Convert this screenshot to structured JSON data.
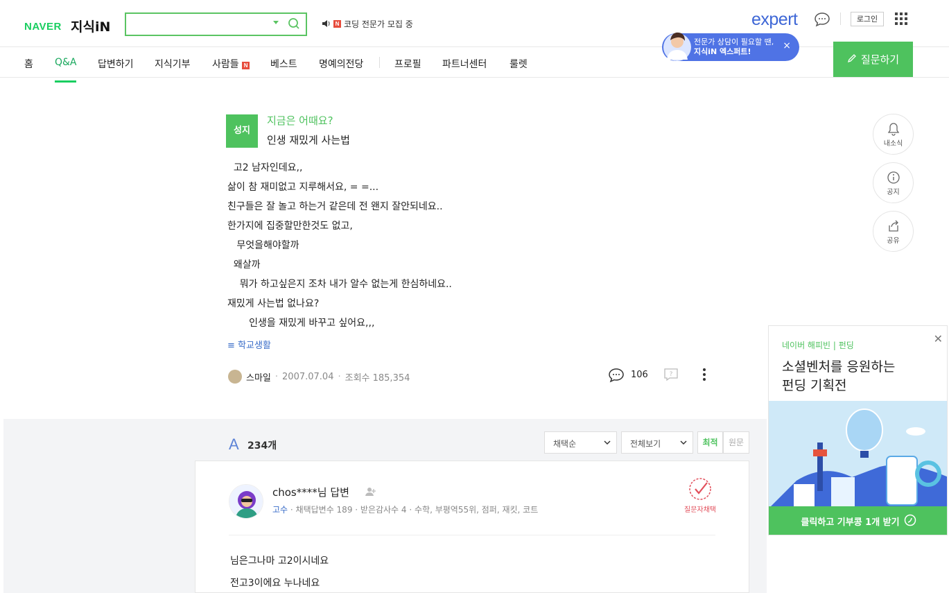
{
  "header": {
    "naver_logo": "NAVER",
    "service_name": "지식iN",
    "search": {
      "value": "",
      "placeholder": ""
    },
    "notice_text": "코딩 전문가 모집 중",
    "expert_logo": "expert",
    "login_label": "로그인"
  },
  "tooltip": {
    "line1": "전문가 상담이 필요할 땐,",
    "line2": "지식iN 엑스퍼트!",
    "close": "×"
  },
  "nav": {
    "items": [
      "홈",
      "Q&A",
      "답변하기",
      "지식기부",
      "사람들",
      "베스트",
      "명예의전당",
      "프로필",
      "파트너센터",
      "룰렛"
    ],
    "active": "Q&A",
    "ask_label": "질문하기"
  },
  "question": {
    "badge": "성지",
    "subtitle": "지금은 어때요?",
    "title": "인생 재밌게 사는법",
    "body": "  고2 남자인데요,,\n삶이 참 재미없고 지루해서요, = =...\n친구들은 잘 놀고 하는거 같은데 전 왠지 잘안되네요..\n한가지에 집중할만한것도 없고,\n   무엇을해야할까\n  왜살까\n    뭐가 하고싶은지 조차 내가 알수 없는게 한심하네요..\n재밌게 사는법 없나요?\n       인생을 재밌게 바꾸고 싶어요,,,",
    "tag": "학교생활",
    "author": "스마일",
    "date": "2007.07.04",
    "views": "조회수 185,354",
    "comment_count": "106"
  },
  "side": {
    "alarm": "내소식",
    "notice": "공지",
    "share": "공유"
  },
  "answers": {
    "count": "234개",
    "sort_select": "채택순",
    "filter_select": "전체보기",
    "sort_best": "최적",
    "sort_original": "원문",
    "first": {
      "name": "chos****님 답변",
      "grade": "고수",
      "meta": " · 채택답변수 189 · 받은감사수 4 · 수학, 부평역55위, 점퍼, 재킷, 코트",
      "chosen_label": "질문자채택",
      "body_line1": "님은그나마 고2이시네요",
      "body_line2": "전고3이에요 누나네요"
    }
  },
  "ad": {
    "tag": "네이버 해피빈 | 펀딩",
    "title_line1": "소셜벤처를 응원하는",
    "title_line2": "펀딩 기획전",
    "cta": "클릭하고 기부콩 1개 받기"
  },
  "colors": {
    "brand_green": "#4ec25e",
    "expert_blue": "#3e67d6",
    "link_blue": "#3a6dc8"
  }
}
